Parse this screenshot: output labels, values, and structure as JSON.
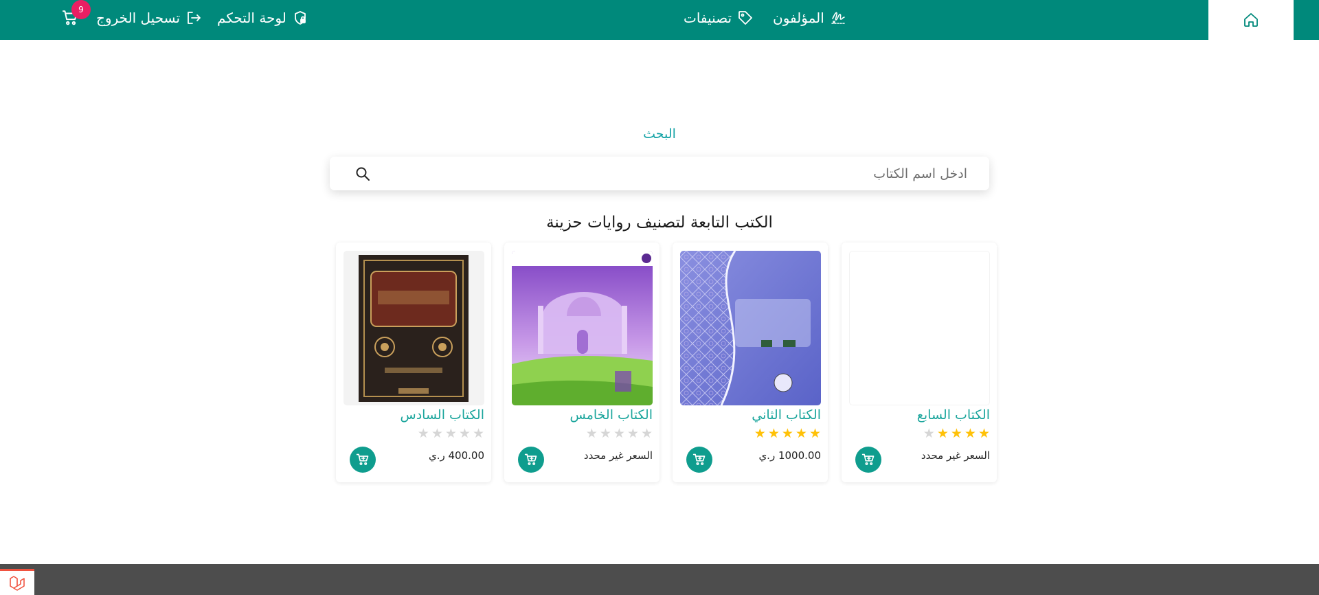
{
  "nav": {
    "authors_label": "المؤلفون",
    "categories_label": "تصنيفات",
    "dashboard_label": "لوحة التحكم",
    "logout_label": "تسحيل الخروج",
    "cart_count": "9"
  },
  "search": {
    "heading": "البحث",
    "placeholder": "ادخل اسم الكتاب"
  },
  "section_title": "الكتب التابعة لتصنيف روايات حزينة",
  "books": [
    {
      "title": "الكتاب السابع",
      "rating": 4,
      "price": "السعر غير محدد",
      "cover": "blank"
    },
    {
      "title": "الكتاب الثاني",
      "rating": 5,
      "price": "1000.00 ر.ي",
      "cover": "islamic-blue"
    },
    {
      "title": "الكتاب الخامس",
      "rating": 0,
      "price": "السعر غير محدد",
      "cover": "mosque-purple"
    },
    {
      "title": "الكتاب السادس",
      "rating": 0,
      "price": "400.00 ر.ي",
      "cover": "dark-ornate"
    }
  ],
  "colors": {
    "brand": "#00897b",
    "accent_text": "#1aa59c",
    "badge": "#e91e63",
    "star_on": "#ffc107",
    "star_off": "#d6d6d6",
    "footer": "#4d4d4d"
  }
}
